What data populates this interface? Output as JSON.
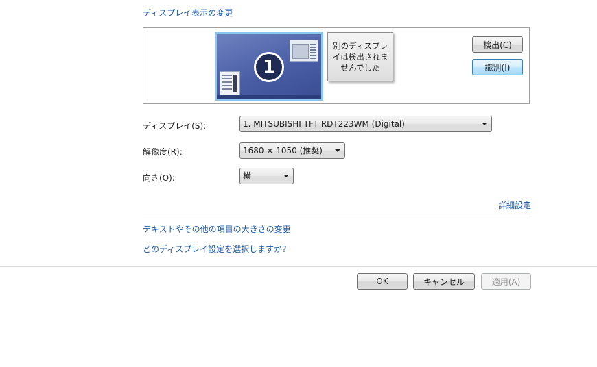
{
  "header": {
    "title": "ディスプレイ表示の変更"
  },
  "preview": {
    "monitor_1": {
      "number": "1"
    },
    "monitor_2": {
      "message": "別のディスプレイは検出されませんでした"
    },
    "detect_label": "検出(C)",
    "identify_label": "識別(I)"
  },
  "settings": {
    "display": {
      "label": "ディスプレイ(S):",
      "value": "1. MITSUBISHI TFT RDT223WM (Digital)"
    },
    "resolution": {
      "label": "解像度(R):",
      "value": "1680 × 1050 (推奨)"
    },
    "orientation": {
      "label": "向き(O):",
      "value": "横"
    }
  },
  "links": {
    "advanced": "詳細設定",
    "text_size": "テキストやその他の項目の大きさの変更",
    "which_settings": "どのディスプレイ設定を選択しますか?"
  },
  "footer": {
    "ok_label": "OK",
    "cancel_label": "キャンセル",
    "apply_label": "適用(A)"
  },
  "colors": {
    "link": "#1e5aa8",
    "monitor_selected_border": "#8ec7ee",
    "monitor_fill": "#4a5ea6"
  }
}
